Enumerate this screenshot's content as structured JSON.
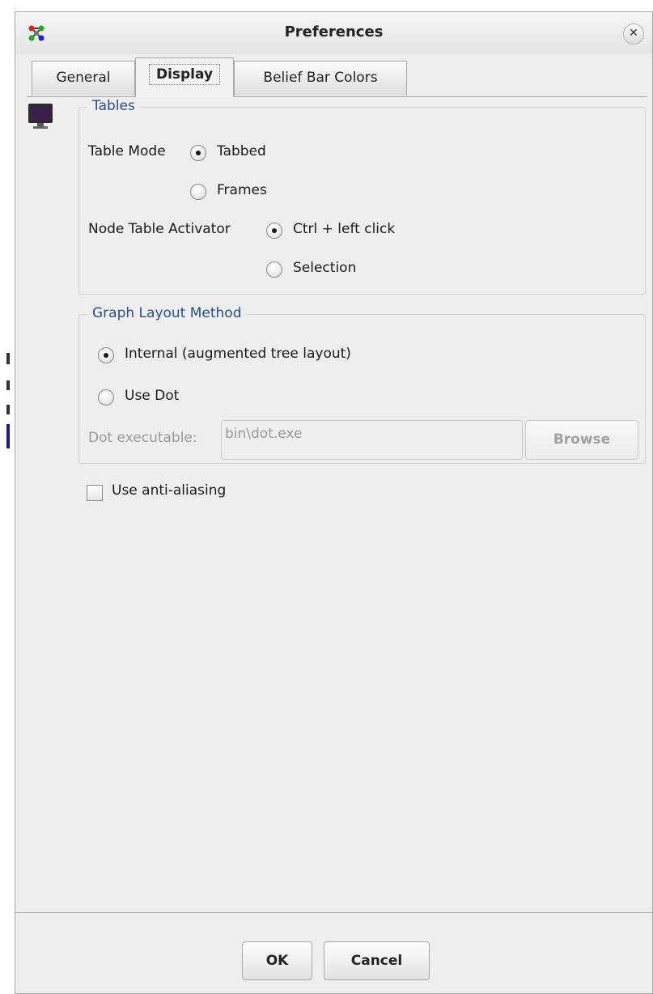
{
  "window": {
    "title": "Preferences"
  },
  "tabs": [
    {
      "label": "General",
      "active": false
    },
    {
      "label": "Display",
      "active": true
    },
    {
      "label": "Belief Bar Colors",
      "active": false
    }
  ],
  "tables": {
    "legend": "Tables",
    "table_mode_label": "Table Mode",
    "table_mode_options": [
      "Tabbed",
      "Frames"
    ],
    "table_mode_selected": "Tabbed",
    "node_table_label": "Node Table Activator",
    "node_table_options": [
      "Ctrl + left click",
      "Selection"
    ],
    "node_table_selected": "Ctrl + left click"
  },
  "graph_layout": {
    "legend": "Graph Layout Method",
    "options": [
      "Internal (augmented tree layout)",
      "Use Dot"
    ],
    "selected": "Internal (augmented tree layout)",
    "dot_label": "Dot executable:",
    "dot_value": "bin\\dot.exe",
    "browse_label": "Browse"
  },
  "antialias": {
    "label": "Use anti-aliasing",
    "checked": false
  },
  "footer": {
    "ok_label": "OK",
    "cancel_label": "Cancel"
  }
}
